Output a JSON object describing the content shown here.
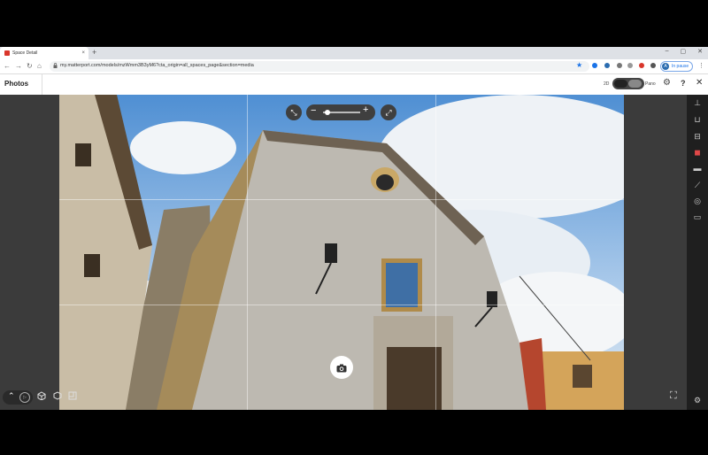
{
  "browser": {
    "tab_title": "Space Detail",
    "tab_close": "×",
    "new_tab": "+",
    "url": "my.matterport.com/models/mzWmm3B3yM6?cta_origin=all_spaces_page&section=media",
    "profile_initial": "A",
    "profile_label": "In pause",
    "window_controls": [
      "–",
      "▢",
      "✕"
    ],
    "menu": "⋮"
  },
  "header": {
    "title": "Photos",
    "view_2d_label": "2D",
    "view_pano_label": "Pano",
    "help": "?",
    "close": "✕"
  },
  "viewer": {
    "zoom_minus": "−",
    "zoom_plus": "+",
    "zoom_level": 0.1
  },
  "icons": {
    "back": "←",
    "forward": "→",
    "reload": "↻",
    "home": "⌂",
    "lock": "🔒",
    "star": "★",
    "gear": "⚙",
    "reset": "⤡",
    "fullscreen": "⤢",
    "camera": "📷",
    "up": "⌃",
    "play": "▷",
    "expand": "⛶"
  },
  "toolbar_right": [
    {
      "name": "tool-measure-icon",
      "glyph": "⊥"
    },
    {
      "name": "tool-floor-icon",
      "glyph": "⊔"
    },
    {
      "name": "tool-layers-icon",
      "glyph": "⊟"
    },
    {
      "name": "tool-photos-icon",
      "glyph": "◼"
    },
    {
      "name": "tool-tag-icon",
      "glyph": "▬"
    },
    {
      "name": "tool-ruler-icon",
      "glyph": "⟋"
    },
    {
      "name": "tool-360-icon",
      "glyph": "◎"
    },
    {
      "name": "tool-video-icon",
      "glyph": "▭"
    },
    {
      "name": "tool-settings-icon",
      "glyph": "⚙"
    }
  ],
  "colors": {
    "accent_red": "#e04848",
    "toolbar_bg": "#1f1f1f",
    "sky": "#5f9ad8"
  }
}
